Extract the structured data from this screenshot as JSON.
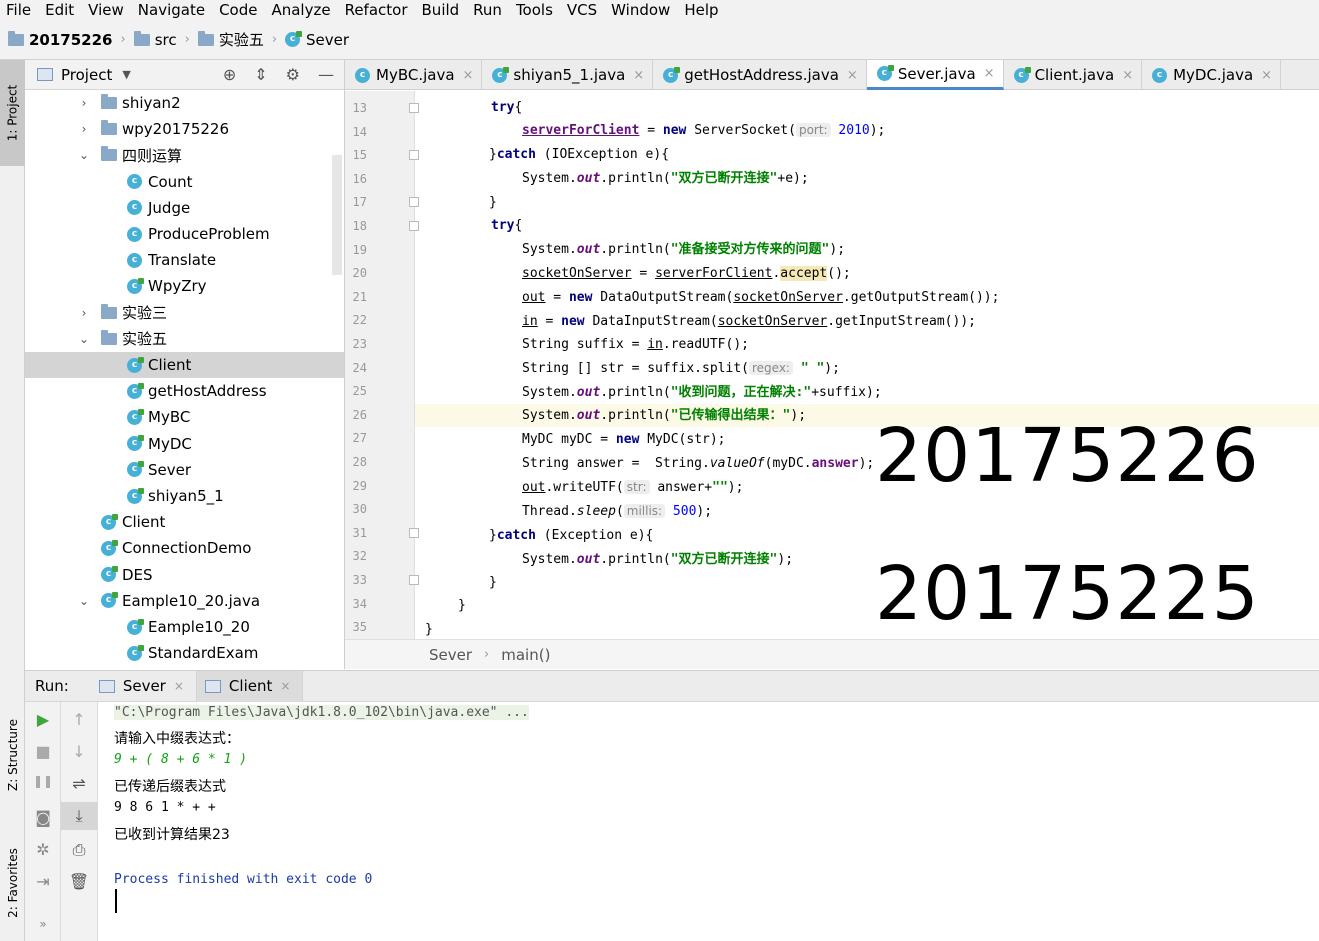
{
  "menu": [
    "File",
    "Edit",
    "View",
    "Navigate",
    "Code",
    "Analyze",
    "Refactor",
    "Build",
    "Run",
    "Tools",
    "VCS",
    "Window",
    "Help"
  ],
  "breadcrumb": [
    "20175226",
    "src",
    "实验五",
    "Sever"
  ],
  "left_strip": {
    "project": "1: Project",
    "structure": "Z: Structure",
    "favorites": "2: Favorites"
  },
  "project_panel": {
    "title": "Project"
  },
  "tree": [
    {
      "label": "shiyan2",
      "type": "folder",
      "arrow": "›"
    },
    {
      "label": "wpy20175226",
      "type": "folder",
      "arrow": "›"
    },
    {
      "label": "四则运算",
      "type": "folder",
      "arrow": "⌄"
    },
    {
      "label": "Count",
      "type": "class"
    },
    {
      "label": "Judge",
      "type": "class"
    },
    {
      "label": "ProduceProblem",
      "type": "class"
    },
    {
      "label": "Translate",
      "type": "class"
    },
    {
      "label": "WpyZry",
      "type": "class"
    },
    {
      "label": "实验三",
      "type": "folder",
      "arrow": "›"
    },
    {
      "label": "实验五",
      "type": "folder",
      "arrow": "⌄"
    },
    {
      "label": "Client",
      "type": "class"
    },
    {
      "label": "getHostAddress",
      "type": "class"
    },
    {
      "label": "MyBC",
      "type": "class"
    },
    {
      "label": "MyDC",
      "type": "class"
    },
    {
      "label": "Sever",
      "type": "class"
    },
    {
      "label": "shiyan5_1",
      "type": "class"
    },
    {
      "label": "Client",
      "type": "class"
    },
    {
      "label": "ConnectionDemo",
      "type": "class"
    },
    {
      "label": "DES",
      "type": "class"
    },
    {
      "label": "Eample10_20.java",
      "type": "class",
      "arrow": "⌄"
    },
    {
      "label": "Eample10_20",
      "type": "class"
    },
    {
      "label": "StandardExam",
      "type": "class"
    }
  ],
  "tabs": [
    {
      "label": "MyBC.java"
    },
    {
      "label": "shiyan5_1.java"
    },
    {
      "label": "getHostAddress.java"
    },
    {
      "label": "Sever.java"
    },
    {
      "label": "Client.java"
    },
    {
      "label": "MyDC.java"
    }
  ],
  "line_numbers": [
    "13",
    "14",
    "15",
    "16",
    "17",
    "18",
    "19",
    "20",
    "21",
    "22",
    "23",
    "24",
    "25",
    "26",
    "27",
    "28",
    "29",
    "30",
    "31",
    "32",
    "33",
    "34",
    "35"
  ],
  "code": {
    "l13": {
      "kw": "try",
      "p": "{"
    },
    "l14": {
      "a": "serverForClient",
      "b": " = ",
      "kw": "new",
      "c": " ServerSocket(",
      "hint": "port:",
      "num": "2010",
      "d": ");"
    },
    "l15": {
      "a": "}",
      "kw": "catch",
      "b": " (IOException e){"
    },
    "l16": {
      "a": "System.",
      "f": "out",
      "b": ".println(",
      "s": "\"双方已断开连接\"",
      "c": "+e);"
    },
    "l17": {
      "a": "}"
    },
    "l18": {
      "kw": "try",
      "p": "{"
    },
    "l19": {
      "a": "System.",
      "f": "out",
      "b": ".println(",
      "s": "\"准备接受对方传来的问题\"",
      "c": ");"
    },
    "l20": {
      "a": "socketOnServer",
      "b": " = ",
      "c": "serverForClient",
      "d": ".",
      "e": "accept",
      "g": "();"
    },
    "l21": {
      "a": "out",
      "b": " = ",
      "kw": "new",
      "c": " DataOutputStream(",
      "d": "socketOnServer",
      "e": ".getOutputStream());"
    },
    "l22": {
      "a": "in",
      "b": " = ",
      "kw": "new",
      "c": " DataInputStream(",
      "d": "socketOnServer",
      "e": ".getInputStream());"
    },
    "l23": {
      "a": "String suffix = ",
      "b": "in",
      "c": ".readUTF();"
    },
    "l24": {
      "a": "String [] str = suffix.split(",
      "hint": "regex:",
      "s": "\" \"",
      "b": ");"
    },
    "l25": {
      "a": "System.",
      "f": "out",
      "b": ".println(",
      "s": "\"收到问题，正在解决:\"",
      "c": "+suffix);"
    },
    "l26": {
      "a": "System.",
      "f": "out",
      "b": ".println(",
      "s": "\"已传输得出结果：\"",
      "c": ");"
    },
    "l27": {
      "a": "MyDC myDC = ",
      "kw": "new",
      "b": " MyDC(str);"
    },
    "l28": {
      "a": "String answer =  String.",
      "i": "valueOf",
      "b": "(myDC.",
      "c": "answer",
      "d": ");"
    },
    "l29": {
      "a": "out",
      "b": ".writeUTF(",
      "hint": "str:",
      "c": " answer+",
      "s": "\"\"",
      "d": ");"
    },
    "l30": {
      "a": "Thread.",
      "i": "sleep",
      "b": "(",
      "hint": "millis:",
      "num": "500",
      "c": ");"
    },
    "l31": {
      "a": "}",
      "kw": "catch",
      "b": " (Exception e){"
    },
    "l32": {
      "a": "System.",
      "f": "out",
      "b": ".println(",
      "s": "\"双方已断开连接\"",
      "c": ");"
    },
    "l33": {
      "a": "}"
    },
    "l34": {
      "a": "}"
    },
    "l35": {
      "a": "}"
    }
  },
  "overlay_numbers": [
    "20175226",
    "20175225"
  ],
  "editor_breadcrumb": [
    "Sever",
    "main()"
  ],
  "run": {
    "label": "Run:",
    "tabs": [
      "Sever",
      "Client"
    ],
    "console": {
      "cmd": "\"C:\\Program Files\\Java\\jdk1.8.0_102\\bin\\java.exe\" ...",
      "l1": "请输入中缀表达式：",
      "l2": "9 + ( 8 + 6 * 1 )",
      "l3": "已传递后缀表达式",
      "l4": "9 8 6 1 * + +",
      "l5": "已收到计算结果23",
      "exit": "Process finished with exit code 0"
    }
  },
  "icons": {
    "tab_close": "×",
    "crumb_sep": "›",
    "run": "▶",
    "stop": "■",
    "pause": "❚❚",
    "camera": "◙",
    "up": "↑",
    "down": "↓",
    "wrap": "⇌",
    "scroll_end": "⤓",
    "print": "⎙",
    "trash": "🗑",
    "more": "»"
  },
  "colors": {
    "accent": "#4a88c7",
    "keyword": "#000080",
    "string": "#008000",
    "field": "#660e7a"
  }
}
